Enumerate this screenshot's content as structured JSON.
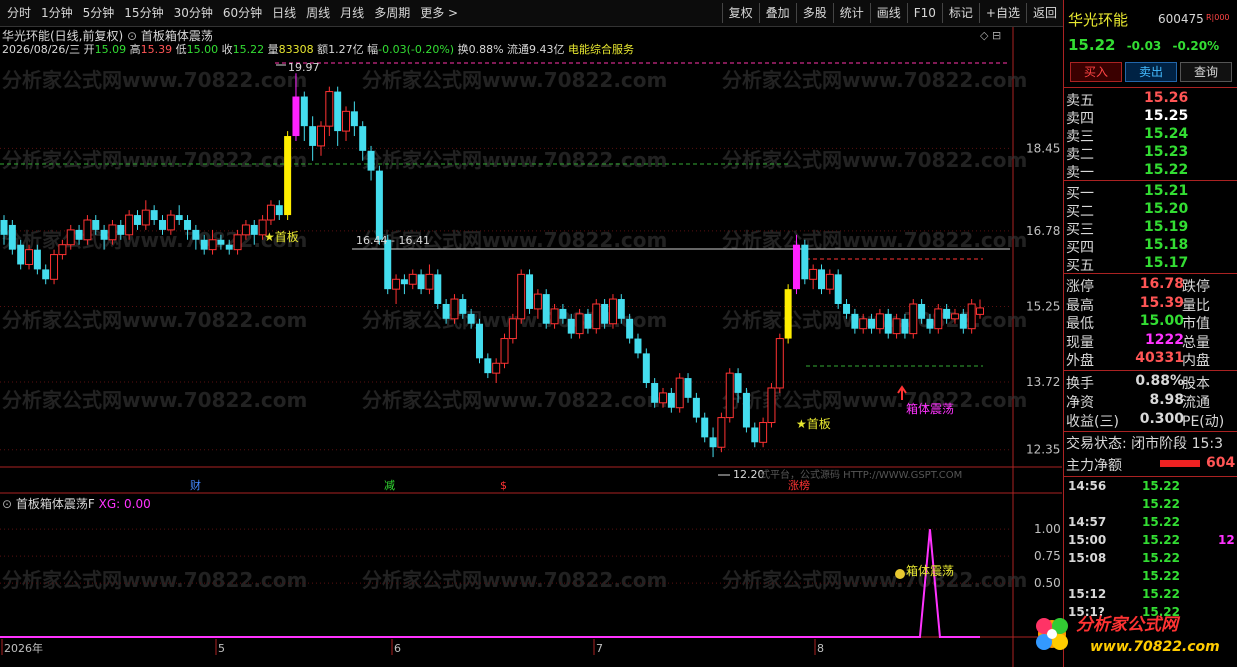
{
  "toolbar": {
    "left": [
      "分时",
      "1分钟",
      "5分钟",
      "15分钟",
      "30分钟",
      "60分钟",
      "日线",
      "周线",
      "月线",
      "多周期",
      "更多 >"
    ],
    "right": [
      "复权",
      "叠加",
      "多股",
      "统计",
      "画线",
      "F10",
      "标记",
      "+自选",
      "返回"
    ]
  },
  "chart_header": {
    "title": "华光环能(日线,前复权)",
    "indicator": "首板箱体震荡",
    "date": "2026/08/26/三",
    "open_label": "开",
    "open": "15.09",
    "high_label": "高",
    "high": "15.39",
    "low_label": "低",
    "low": "15.00",
    "close_label": "收",
    "close": "15.22",
    "vol_label": "量",
    "vol": "83308",
    "amt_label": "额",
    "amt": "1.27亿",
    "chg_label": "幅",
    "chg": "-0.03(-0.20%)",
    "turn_label": "换",
    "turn": "0.88%",
    "float_label": "流通",
    "float": "9.43亿",
    "industry": "电能综合服务"
  },
  "price_axis": [
    "18.45",
    "16.78",
    "15.25",
    "13.72",
    "12.35"
  ],
  "annotations": {
    "peak": "19.97",
    "trough": "12.20",
    "box_range": "16.44 - 16.41",
    "first_board": "★首板",
    "first_board_2": "★首板",
    "box_signal": "箱体震荡",
    "watermark_small": "式平台，公式源码 HTTP://WWW.GSPT.COM"
  },
  "event_marks": [
    {
      "label": "财",
      "color": "#4488ff"
    },
    {
      "label": "减",
      "color": "#33dd33"
    },
    {
      "label": "$",
      "color": "#ff3333"
    },
    {
      "label": "涨榜",
      "color": "#ff3333"
    }
  ],
  "sub_chart": {
    "title": "首板箱体震荡F",
    "xg_label": "XG: 0.00",
    "axis": [
      "1.00",
      "0.75",
      "0.50"
    ],
    "signal_label": "箱体震荡"
  },
  "time_axis": [
    "2026年",
    "5",
    "6",
    "7",
    "8"
  ],
  "watermark": "分析家公式网www.70822.com",
  "right_panel": {
    "name": "华光环能",
    "code": "600475",
    "badge": "R|000",
    "price": "15.22",
    "change": "-0.03",
    "change_pct": "-0.20%",
    "buy_btn": "买入",
    "sell_btn": "卖出",
    "query_btn": "查询",
    "asks": [
      {
        "label": "卖五",
        "price": "15.26",
        "color": "#ff5555"
      },
      {
        "label": "卖四",
        "price": "15.25",
        "color": "#ffffff"
      },
      {
        "label": "卖三",
        "price": "15.24",
        "color": "#33dd33"
      },
      {
        "label": "卖二",
        "price": "15.23",
        "color": "#33dd33"
      },
      {
        "label": "卖一",
        "price": "15.22",
        "color": "#33dd33"
      }
    ],
    "bids": [
      {
        "label": "买一",
        "price": "15.21",
        "color": "#33dd33"
      },
      {
        "label": "买二",
        "price": "15.20",
        "color": "#33dd33"
      },
      {
        "label": "买三",
        "price": "15.19",
        "color": "#33dd33"
      },
      {
        "label": "买四",
        "price": "15.18",
        "color": "#33dd33"
      },
      {
        "label": "买五",
        "price": "15.17",
        "color": "#33dd33"
      }
    ],
    "stats1": [
      {
        "l1": "涨停",
        "v1": "16.78",
        "c": "#ff5555",
        "l2": "跌停"
      },
      {
        "l1": "最高",
        "v1": "15.39",
        "c": "#ff5555",
        "l2": "量比"
      },
      {
        "l1": "最低",
        "v1": "15.00",
        "c": "#33dd33",
        "l2": "市值"
      },
      {
        "l1": "现量",
        "v1": "1222",
        "c": "#ff33ff",
        "l2": "总量"
      },
      {
        "l1": "外盘",
        "v1": "40331",
        "c": "#ff5555",
        "l2": "内盘"
      }
    ],
    "stats2": [
      {
        "l1": "换手",
        "v1": "0.88%",
        "c": "#d8d8d8",
        "l2": "股本"
      },
      {
        "l1": "净资",
        "v1": "8.98",
        "c": "#d8d8d8",
        "l2": "流通"
      },
      {
        "l1": "收益(三)",
        "v1": "0.300",
        "c": "#d8d8d8",
        "l2": "PE(动)"
      }
    ],
    "trade_state": "交易状态: 闭市阶段 15:3",
    "main_flow_label": "主力净额",
    "main_flow_value": "604",
    "ticks": [
      {
        "t": "14:56",
        "p": "15.22",
        "v": ""
      },
      {
        "t": "",
        "p": "15.22",
        "v": ""
      },
      {
        "t": "14:57",
        "p": "15.22",
        "v": ""
      },
      {
        "t": "15:00",
        "p": "15.22",
        "v": "12"
      },
      {
        "t": "15:08",
        "p": "15.22",
        "v": ""
      },
      {
        "t": "",
        "p": "15.22",
        "v": ""
      },
      {
        "t": "15:12",
        "p": "15.22",
        "v": ""
      },
      {
        "t": "15:1?",
        "p": "15.22",
        "v": ""
      }
    ],
    "logo_text": "分析家公式网",
    "logo_url": "www.70822.com"
  },
  "candles": [
    [
      17.0,
      16.7,
      17.1,
      16.5
    ],
    [
      16.9,
      16.4,
      17.0,
      16.3
    ],
    [
      16.5,
      16.1,
      16.6,
      16.0
    ],
    [
      16.1,
      16.4,
      16.5,
      16.0
    ],
    [
      16.4,
      16.0,
      16.5,
      15.9
    ],
    [
      16.0,
      15.8,
      16.1,
      15.7
    ],
    [
      15.8,
      16.3,
      16.4,
      15.7
    ],
    [
      16.3,
      16.5,
      16.6,
      16.2
    ],
    [
      16.5,
      16.8,
      16.9,
      16.4
    ],
    [
      16.8,
      16.6,
      16.9,
      16.5
    ],
    [
      16.6,
      17.0,
      17.1,
      16.5
    ],
    [
      17.0,
      16.8,
      17.1,
      16.7
    ],
    [
      16.8,
      16.6,
      16.9,
      16.4
    ],
    [
      16.6,
      16.9,
      17.0,
      16.5
    ],
    [
      16.9,
      16.7,
      17.0,
      16.6
    ],
    [
      16.7,
      17.1,
      17.2,
      16.6
    ],
    [
      17.1,
      16.9,
      17.2,
      16.8
    ],
    [
      16.9,
      17.2,
      17.4,
      16.8
    ],
    [
      17.2,
      17.0,
      17.3,
      16.9
    ],
    [
      17.0,
      16.8,
      17.1,
      16.7
    ],
    [
      16.8,
      17.1,
      17.2,
      16.7
    ],
    [
      17.1,
      17.0,
      17.3,
      16.9
    ],
    [
      17.0,
      16.8,
      17.1,
      16.6
    ],
    [
      16.8,
      16.6,
      16.9,
      16.4
    ],
    [
      16.6,
      16.4,
      16.7,
      16.3
    ],
    [
      16.4,
      16.6,
      16.8,
      16.3
    ],
    [
      16.6,
      16.5,
      16.7,
      16.4
    ],
    [
      16.5,
      16.4,
      16.6,
      16.3
    ],
    [
      16.4,
      16.7,
      16.8,
      16.3
    ],
    [
      16.7,
      16.9,
      17.0,
      16.6
    ],
    [
      16.9,
      16.7,
      17.0,
      16.5
    ],
    [
      16.7,
      17.0,
      17.1,
      16.6
    ],
    [
      17.0,
      17.3,
      17.4,
      16.9
    ],
    [
      17.3,
      17.1,
      17.4,
      17.0
    ],
    [
      17.1,
      18.7,
      18.8,
      17.0
    ],
    [
      18.7,
      19.5,
      19.97,
      18.6
    ],
    [
      19.5,
      18.9,
      19.6,
      18.6
    ],
    [
      18.9,
      18.5,
      19.1,
      18.2
    ],
    [
      18.5,
      18.9,
      19.0,
      18.3
    ],
    [
      18.9,
      19.6,
      19.7,
      18.7
    ],
    [
      19.6,
      18.8,
      19.7,
      18.5
    ],
    [
      18.8,
      19.2,
      19.3,
      18.6
    ],
    [
      19.2,
      18.9,
      19.4,
      18.7
    ],
    [
      18.9,
      18.4,
      19.0,
      18.2
    ],
    [
      18.4,
      18.0,
      18.5,
      17.8
    ],
    [
      18.0,
      16.6,
      18.1,
      16.5
    ],
    [
      16.6,
      15.6,
      16.7,
      15.5
    ],
    [
      15.6,
      15.8,
      15.9,
      15.3
    ],
    [
      15.8,
      15.7,
      15.9,
      15.5
    ],
    [
      15.7,
      15.9,
      16.0,
      15.6
    ],
    [
      15.9,
      15.6,
      16.0,
      15.5
    ],
    [
      15.6,
      15.9,
      16.1,
      15.5
    ],
    [
      15.9,
      15.3,
      16.0,
      15.2
    ],
    [
      15.3,
      15.0,
      15.4,
      14.9
    ],
    [
      15.0,
      15.4,
      15.5,
      14.9
    ],
    [
      15.4,
      15.1,
      15.5,
      15.0
    ],
    [
      15.1,
      14.9,
      15.2,
      14.8
    ],
    [
      14.9,
      14.2,
      15.0,
      14.1
    ],
    [
      14.2,
      13.9,
      14.3,
      13.8
    ],
    [
      13.9,
      14.1,
      14.2,
      13.7
    ],
    [
      14.1,
      14.6,
      14.7,
      14.0
    ],
    [
      14.6,
      15.0,
      15.1,
      14.5
    ],
    [
      15.0,
      15.9,
      16.0,
      14.9
    ],
    [
      15.9,
      15.2,
      16.0,
      15.1
    ],
    [
      15.2,
      15.5,
      15.6,
      15.0
    ],
    [
      15.5,
      14.9,
      15.6,
      14.8
    ],
    [
      14.9,
      15.2,
      15.3,
      14.8
    ],
    [
      15.2,
      15.0,
      15.3,
      14.9
    ],
    [
      15.0,
      14.7,
      15.1,
      14.6
    ],
    [
      14.7,
      15.1,
      15.2,
      14.6
    ],
    [
      15.1,
      14.8,
      15.2,
      14.7
    ],
    [
      14.8,
      15.3,
      15.4,
      14.7
    ],
    [
      15.3,
      14.9,
      15.4,
      14.8
    ],
    [
      14.9,
      15.4,
      15.5,
      14.8
    ],
    [
      15.4,
      15.0,
      15.5,
      14.9
    ],
    [
      15.0,
      14.6,
      15.1,
      14.5
    ],
    [
      14.6,
      14.3,
      14.7,
      14.2
    ],
    [
      14.3,
      13.7,
      14.4,
      13.6
    ],
    [
      13.7,
      13.3,
      13.8,
      13.2
    ],
    [
      13.3,
      13.5,
      13.6,
      13.2
    ],
    [
      13.5,
      13.2,
      13.6,
      13.1
    ],
    [
      13.2,
      13.8,
      13.9,
      13.1
    ],
    [
      13.8,
      13.4,
      13.9,
      13.3
    ],
    [
      13.4,
      13.0,
      13.5,
      12.9
    ],
    [
      13.0,
      12.6,
      13.1,
      12.5
    ],
    [
      12.6,
      12.4,
      12.8,
      12.2
    ],
    [
      12.4,
      13.0,
      13.1,
      12.3
    ],
    [
      13.0,
      13.9,
      14.0,
      12.9
    ],
    [
      13.9,
      13.5,
      14.0,
      13.3
    ],
    [
      13.5,
      12.8,
      13.6,
      12.7
    ],
    [
      12.8,
      12.5,
      12.9,
      12.4
    ],
    [
      12.5,
      12.9,
      13.0,
      12.4
    ],
    [
      12.9,
      13.6,
      13.7,
      12.8
    ],
    [
      13.6,
      14.6,
      14.7,
      13.5
    ],
    [
      14.6,
      15.6,
      15.7,
      14.5
    ],
    [
      15.6,
      16.5,
      16.7,
      15.5
    ],
    [
      16.5,
      15.8,
      16.6,
      15.7
    ],
    [
      15.8,
      16.0,
      16.1,
      15.6
    ],
    [
      16.0,
      15.6,
      16.1,
      15.5
    ],
    [
      15.6,
      15.9,
      16.0,
      15.5
    ],
    [
      15.9,
      15.3,
      16.0,
      15.2
    ],
    [
      15.3,
      15.1,
      15.4,
      15.0
    ],
    [
      15.1,
      14.8,
      15.2,
      14.7
    ],
    [
      14.8,
      15.0,
      15.1,
      14.7
    ],
    [
      15.0,
      14.8,
      15.1,
      14.7
    ],
    [
      14.8,
      15.1,
      15.2,
      14.7
    ],
    [
      15.1,
      14.7,
      15.2,
      14.6
    ],
    [
      14.7,
      15.0,
      15.1,
      14.6
    ],
    [
      15.0,
      14.7,
      15.1,
      14.6
    ],
    [
      14.7,
      15.3,
      15.4,
      14.6
    ],
    [
      15.3,
      15.0,
      15.4,
      14.9
    ],
    [
      15.0,
      14.8,
      15.1,
      14.7
    ],
    [
      14.8,
      15.2,
      15.3,
      14.7
    ],
    [
      15.2,
      15.0,
      15.3,
      14.9
    ],
    [
      15.0,
      15.1,
      15.2,
      14.9
    ],
    [
      15.1,
      14.8,
      15.2,
      14.7
    ],
    [
      14.8,
      15.3,
      15.4,
      14.7
    ],
    [
      15.09,
      15.22,
      15.39,
      15.0
    ]
  ]
}
